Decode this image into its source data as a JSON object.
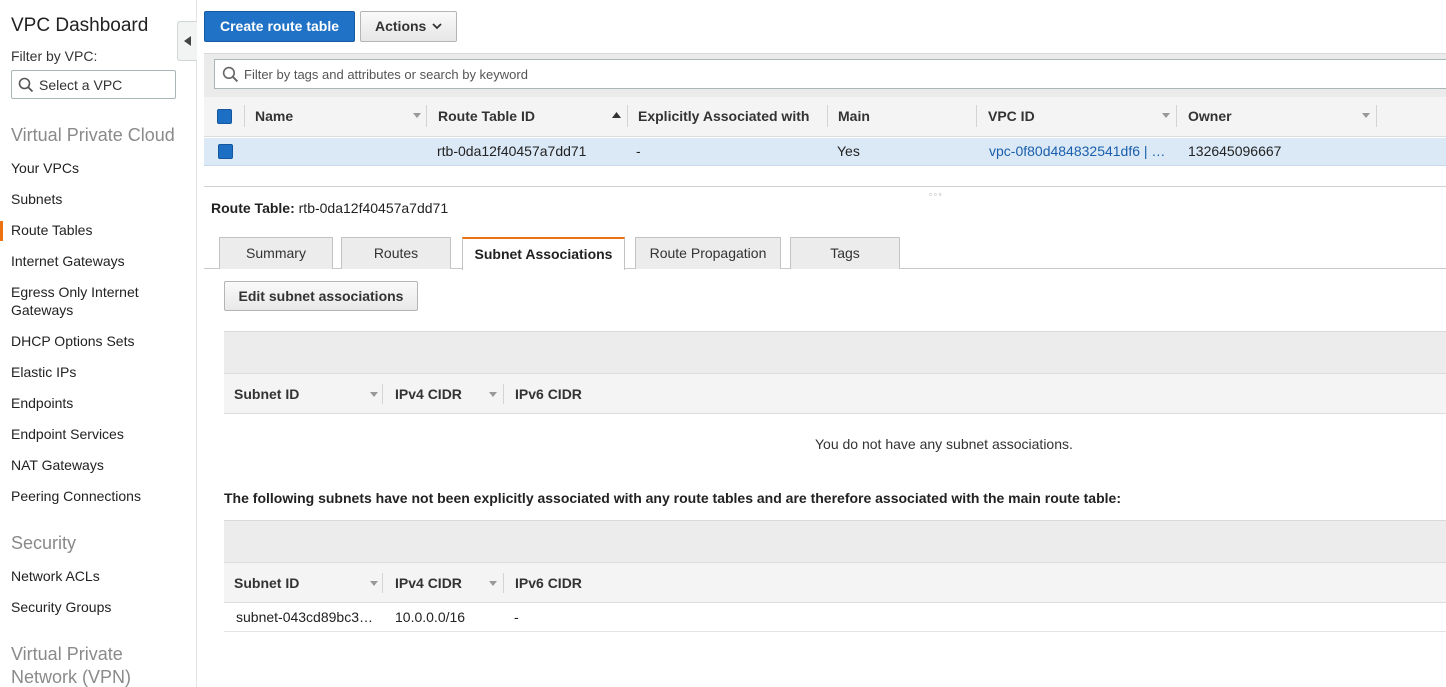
{
  "sidebar": {
    "title": "VPC Dashboard",
    "filter_label": "Filter by VPC:",
    "select_placeholder": "Select a VPC",
    "sections": [
      {
        "heading": "Virtual Private Cloud",
        "items": [
          "Your VPCs",
          "Subnets",
          "Route Tables",
          "Internet Gateways",
          "Egress Only Internet Gateways",
          "DHCP Options Sets",
          "Elastic IPs",
          "Endpoints",
          "Endpoint Services",
          "NAT Gateways",
          "Peering Connections"
        ]
      },
      {
        "heading": "Security",
        "items": [
          "Network ACLs",
          "Security Groups"
        ]
      },
      {
        "heading": "Virtual Private Network (VPN)",
        "items": []
      }
    ],
    "active_item": "Route Tables",
    "accent_color": "#ec7211"
  },
  "toolbar": {
    "create_label": "Create route table",
    "actions_label": "Actions"
  },
  "filter": {
    "placeholder": "Filter by tags and attributes or search by keyword"
  },
  "grid": {
    "columns": [
      "Name",
      "Route Table ID",
      "Explicitly Associated with",
      "Main",
      "VPC ID",
      "Owner"
    ],
    "rows": [
      {
        "name": "",
        "route_table_id": "rtb-0da12f40457a7dd71",
        "explicitly_associated_with": "-",
        "main": "Yes",
        "vpc_id": "vpc-0f80d484832541df6 | …",
        "owner": "132645096667"
      }
    ]
  },
  "detail": {
    "label": "Route Table:",
    "value": "rtb-0da12f40457a7dd71",
    "tabs": [
      "Summary",
      "Routes",
      "Subnet Associations",
      "Route Propagation",
      "Tags"
    ],
    "active_tab": "Subnet Associations",
    "edit_label": "Edit subnet associations",
    "subnet_columns": [
      "Subnet ID",
      "IPv4 CIDR",
      "IPv6 CIDR"
    ],
    "empty_message": "You do not have any subnet associations.",
    "implicit_heading": "The following subnets have not been explicitly associated with any route tables and are therefore associated with the main route table:",
    "implicit_rows": [
      {
        "subnet_id": "subnet-043cd89bc3…",
        "ipv4_cidr": "10.0.0.0/16",
        "ipv6_cidr": "-"
      }
    ]
  }
}
